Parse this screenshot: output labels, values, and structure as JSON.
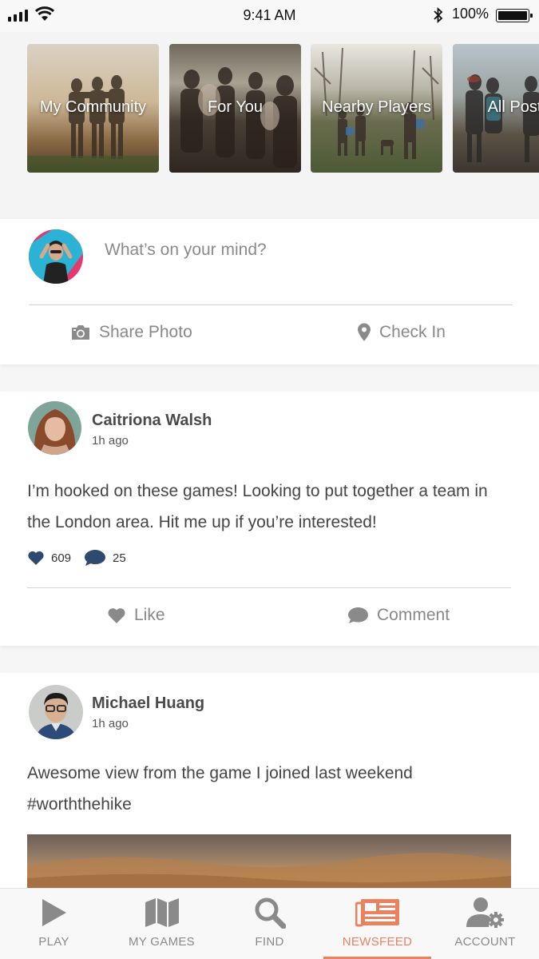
{
  "status_bar": {
    "time": "9:41 AM",
    "battery": "100%"
  },
  "categories": [
    {
      "label": "My Community"
    },
    {
      "label": "For You"
    },
    {
      "label": "Nearby Players"
    },
    {
      "label": "All Posts"
    }
  ],
  "composer": {
    "placeholder": "What’s on your mind?",
    "share_photo": "Share Photo",
    "check_in": "Check In"
  },
  "posts": [
    {
      "author": "Caitriona Walsh",
      "time": "1h ago",
      "text": "I’m hooked on these games! Looking to put together a team in the London area. Hit me up if you’re interested!",
      "likes": "609",
      "comments": "25",
      "like_label": "Like",
      "comment_label": "Comment"
    },
    {
      "author": "Michael Huang",
      "time": "1h ago",
      "text": "Awesome view from the game I joined last weekend #worththehike"
    }
  ],
  "tabbar": {
    "tabs": [
      {
        "label": "PLAY",
        "icon": "play-icon"
      },
      {
        "label": "MY GAMES",
        "icon": "map-icon"
      },
      {
        "label": "FIND",
        "icon": "search-icon"
      },
      {
        "label": "NEWSFEED",
        "icon": "newspaper-icon",
        "active": true
      },
      {
        "label": "ACCOUNT",
        "icon": "account-settings-icon"
      }
    ]
  },
  "colors": {
    "accent": "#e9825f",
    "like_blue": "#2e4a6e",
    "icon_gray": "#8a8a8a"
  }
}
